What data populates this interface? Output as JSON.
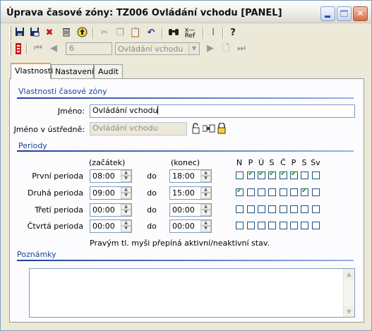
{
  "window": {
    "title": "Úprava časové zóny: TZ006 Ovládání vchodu [PANEL]",
    "controls": {
      "minimize": "minimize-icon",
      "maximize": "maximize-icon",
      "close": "close-icon"
    }
  },
  "toolbar": {
    "icons": [
      "save-icon",
      "save-close-icon",
      "delete-icon",
      "trash-icon",
      "up-icon",
      "cut-icon",
      "copy-icon",
      "paste-icon",
      "undo-icon",
      "find-icon",
      "clear-ref-icon",
      "text-cursor-icon",
      "help-icon"
    ],
    "ref_label": "Ref"
  },
  "navigator": {
    "record_number": "6",
    "record_name": "Ovládání vchodu"
  },
  "tabs": [
    {
      "label": "Vlastnosti",
      "active": true
    },
    {
      "label": "Nastavení",
      "active": false
    },
    {
      "label": "Audit",
      "active": false
    }
  ],
  "properties": {
    "section_title": "Vlastnosti časové zóny",
    "name_label": "Jméno:",
    "name_value": "Ovládání vchodu",
    "central_name_label": "Jméno v ústředně:",
    "central_name_value": "Ovládání vchodu"
  },
  "periods": {
    "section_title": "Periody",
    "start_header": "(začátek)",
    "end_header": "(konec)",
    "to_label": "do",
    "days": [
      "N",
      "P",
      "Ú",
      "S",
      "Č",
      "P",
      "S",
      "Sv"
    ],
    "rows": [
      {
        "label": "První perioda",
        "start": "08:00",
        "end": "18:00",
        "days": [
          false,
          true,
          true,
          true,
          true,
          true,
          false,
          false
        ]
      },
      {
        "label": "Druhá perioda",
        "start": "09:00",
        "end": "15:00",
        "days": [
          true,
          false,
          false,
          false,
          false,
          false,
          true,
          false
        ]
      },
      {
        "label": "Třetí perioda",
        "start": "00:00",
        "end": "00:00",
        "days": [
          false,
          false,
          false,
          false,
          false,
          false,
          false,
          false
        ]
      },
      {
        "label": "Čtvrtá perioda",
        "start": "00:00",
        "end": "00:00",
        "days": [
          false,
          false,
          false,
          false,
          false,
          false,
          false,
          false
        ]
      }
    ],
    "hint": "Pravým tl. myši přepíná aktivní/neaktivní stav."
  },
  "notes": {
    "section_title": "Poznámky",
    "value": ""
  }
}
